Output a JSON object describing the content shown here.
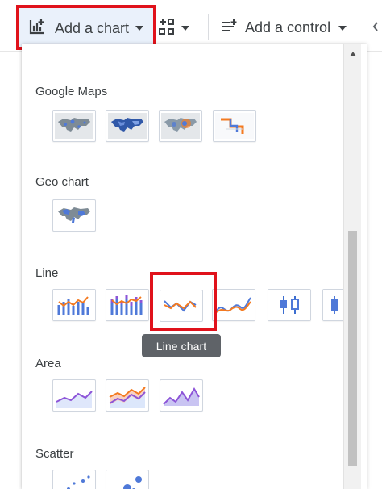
{
  "toolbar": {
    "add_chart_label": "Add a chart",
    "add_control_label": "Add a control"
  },
  "dropdown": {
    "sections": [
      {
        "label": "Google Maps"
      },
      {
        "label": "Geo chart"
      },
      {
        "label": "Line"
      },
      {
        "label": "Area"
      },
      {
        "label": "Scatter"
      }
    ],
    "tooltip": "Line chart"
  },
  "colors": {
    "highlight": "#e0121b",
    "blue": "#4f79d8",
    "orange": "#f47a20",
    "purple": "#8d55d8",
    "tooltip_bg": "#5f6368",
    "selected_bg": "#eaf1fb"
  }
}
